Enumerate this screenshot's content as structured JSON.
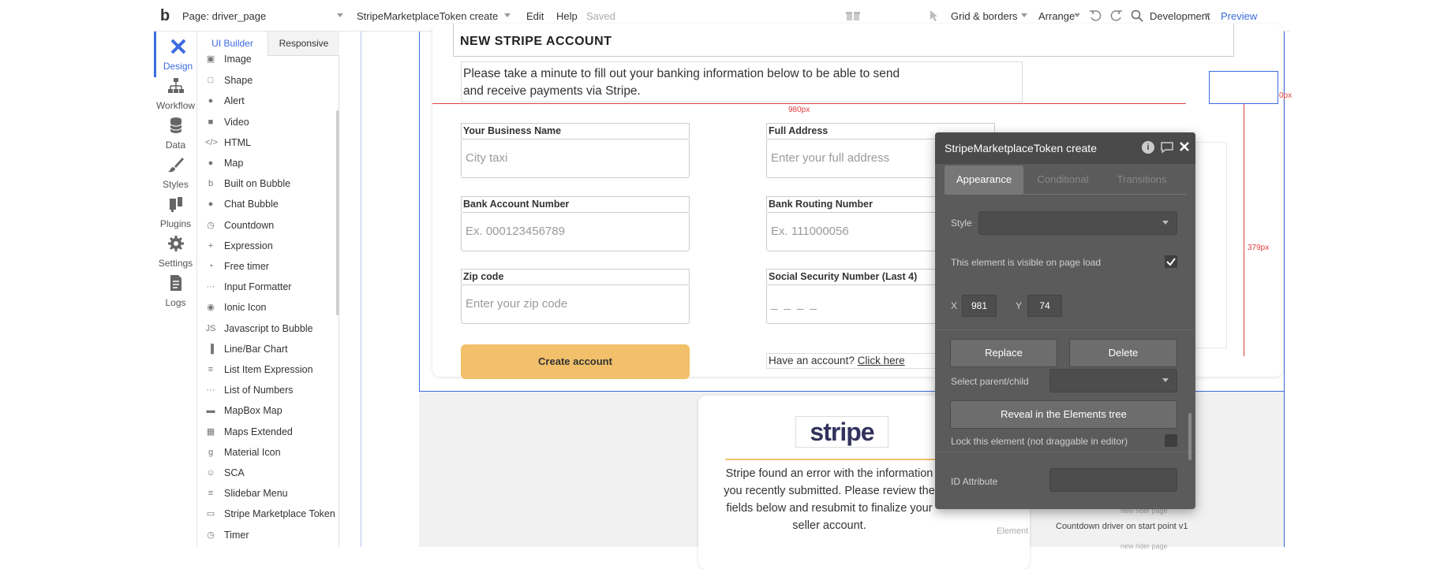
{
  "topbar": {
    "page_label": "Page: driver_page",
    "element_select": "StripeMarketplaceToken create",
    "edit": "Edit",
    "help": "Help",
    "saved": "Saved",
    "grid_borders": "Grid & borders",
    "arrange": "Arrange",
    "development": "Development",
    "preview": "Preview"
  },
  "rail": [
    {
      "label": "Design",
      "icon": "design-icon"
    },
    {
      "label": "Workflow",
      "icon": "workflow-icon"
    },
    {
      "label": "Data",
      "icon": "database-icon"
    },
    {
      "label": "Styles",
      "icon": "brush-icon"
    },
    {
      "label": "Plugins",
      "icon": "plug-icon"
    },
    {
      "label": "Settings",
      "icon": "gear-icon"
    },
    {
      "label": "Logs",
      "icon": "document-icon"
    }
  ],
  "palette": {
    "tabs": [
      "UI Builder",
      "Responsive"
    ],
    "items": [
      {
        "label": "Image",
        "glyph": "▣"
      },
      {
        "label": "Shape",
        "glyph": "□"
      },
      {
        "label": "Alert",
        "glyph": "●"
      },
      {
        "label": "Video",
        "glyph": "■"
      },
      {
        "label": "HTML",
        "glyph": "</>"
      },
      {
        "label": "Map",
        "glyph": "●"
      },
      {
        "label": "Built on Bubble",
        "glyph": "b"
      },
      {
        "label": "Chat Bubble",
        "glyph": "●"
      },
      {
        "label": "Countdown",
        "glyph": "◷"
      },
      {
        "label": "Expression",
        "glyph": "+"
      },
      {
        "label": "Free timer",
        "glyph": "◔"
      },
      {
        "label": "Input Formatter",
        "glyph": "···"
      },
      {
        "label": "Ionic Icon",
        "glyph": "◉"
      },
      {
        "label": "Javascript to Bubble",
        "glyph": "JS"
      },
      {
        "label": "Line/Bar Chart",
        "glyph": "▐"
      },
      {
        "label": "List Item Expression",
        "glyph": "≡"
      },
      {
        "label": "List of Numbers",
        "glyph": "···"
      },
      {
        "label": "MapBox Map",
        "glyph": "▬"
      },
      {
        "label": "Maps Extended",
        "glyph": "▦"
      },
      {
        "label": "Material Icon",
        "glyph": "g"
      },
      {
        "label": "SCA",
        "glyph": "☺"
      },
      {
        "label": "Slidebar Menu",
        "glyph": "≡"
      },
      {
        "label": "Stripe Marketplace Token",
        "glyph": "▭"
      },
      {
        "label": "Timer",
        "glyph": "◷"
      }
    ]
  },
  "form": {
    "heading": "NEW STRIPE ACCOUNT",
    "intro": "Please take a minute to fill out your banking information below to be able to send and receive payments via Stripe.",
    "fields": [
      {
        "label": "Your Business Name",
        "placeholder": "City taxi"
      },
      {
        "label": "Full Address",
        "placeholder": "Enter your full address"
      },
      {
        "label": "Bank Account Number",
        "placeholder": "Ex. 000123456789"
      },
      {
        "label": "Bank Routing Number",
        "placeholder": "Ex. 111000056"
      },
      {
        "label": "Zip code",
        "placeholder": "Enter your zip code"
      },
      {
        "label": "Social Security Number (Last 4)",
        "placeholder": "_ _ _ _"
      }
    ],
    "create_button": "Create account",
    "have_account": "Have an account?",
    "click_here": "Click here",
    "guide_980": "980px",
    "guide_0": "0px",
    "guide_379": "379px",
    "button_color": "#f2c06a"
  },
  "stripe_card": {
    "logo": "stripe",
    "message": "Stripe found an error with the information you recently submitted. Please review the fields below and resubmit to finalize your seller account."
  },
  "behind_panel": {
    "element_label": "Element",
    "element_value": "Countdown driver on start point v1",
    "page_hint": "new rider page",
    "page_hint2": "new rider page"
  },
  "panel": {
    "title": "StripeMarketplaceToken create",
    "tabs": [
      "Appearance",
      "Conditional",
      "Transitions"
    ],
    "style_label": "Style",
    "visible_label": "This element is visible on page load",
    "x_label": "X",
    "x_value": "981",
    "y_label": "Y",
    "y_value": "74",
    "replace": "Replace",
    "delete": "Delete",
    "select_parent": "Select parent/child",
    "reveal": "Reveal in the Elements tree",
    "lock": "Lock this element (not draggable in editor)",
    "id_attr": "ID Attribute"
  },
  "colors": {
    "accent": "#3b6be0",
    "guide": "#e04040",
    "panel_bg": "#5b5b5b"
  }
}
